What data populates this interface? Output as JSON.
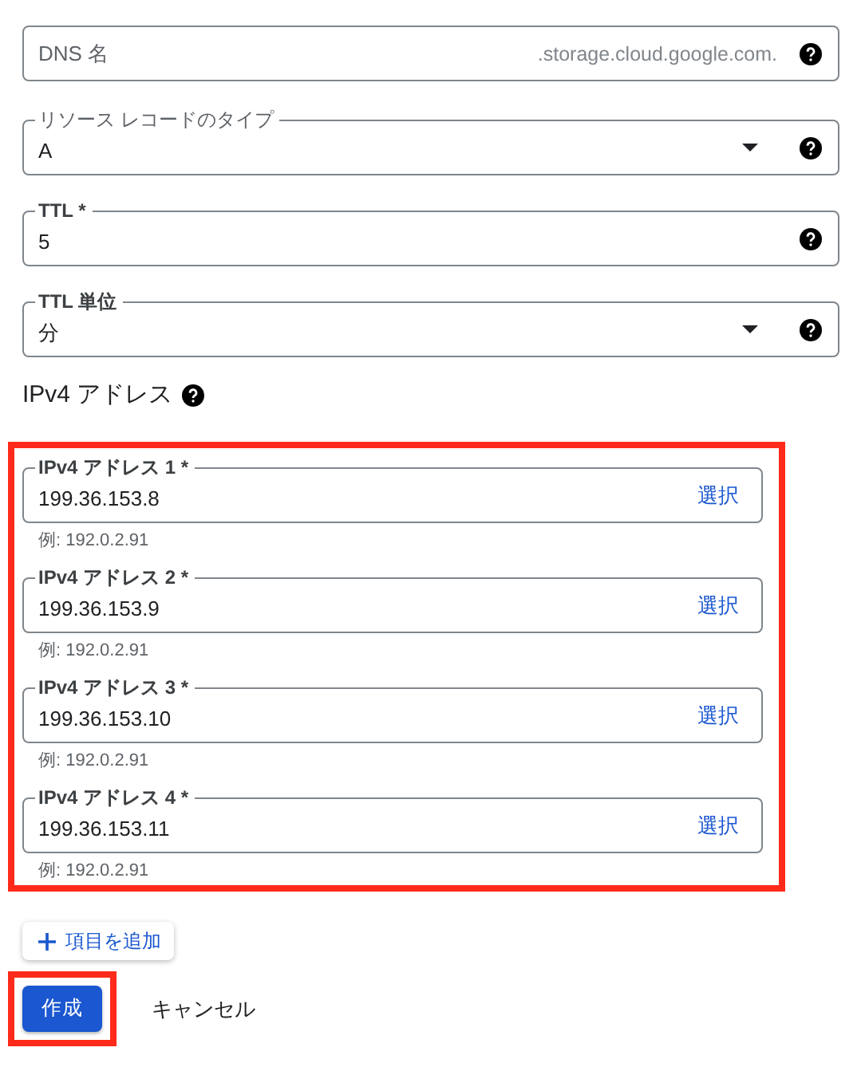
{
  "fields": [
    {
      "kind": "text",
      "placeholder": "DNS 名",
      "suffix": ".storage.cloud.google.com.",
      "help": true
    },
    {
      "kind": "select",
      "label": "リソース レコードのタイプ",
      "label_bold": false,
      "value": "A",
      "help": true
    },
    {
      "kind": "text",
      "label": "TTL *",
      "label_bold": true,
      "value": "5",
      "help": true
    },
    {
      "kind": "select",
      "label": "TTL 単位",
      "label_bold": true,
      "value": "分",
      "help": true
    }
  ],
  "ipv4_section": {
    "heading": "IPv4 アドレス",
    "help": true,
    "highlighted": true,
    "addresses": [
      {
        "label": "IPv4 アドレス 1 *",
        "value": "199.36.153.8",
        "action": "選択",
        "hint": "例: 192.0.2.91"
      },
      {
        "label": "IPv4 アドレス 2 *",
        "value": "199.36.153.9",
        "action": "選択",
        "hint": "例: 192.0.2.91"
      },
      {
        "label": "IPv4 アドレス 3 *",
        "value": "199.36.153.10",
        "action": "選択",
        "hint": "例: 192.0.2.91"
      },
      {
        "label": "IPv4 アドレス 4 *",
        "value": "199.36.153.11",
        "action": "選択",
        "hint": "例: 192.0.2.91"
      }
    ],
    "add_button": "項目を追加"
  },
  "actions": {
    "create": "作成",
    "create_highlighted": true,
    "cancel": "キャンセル"
  }
}
